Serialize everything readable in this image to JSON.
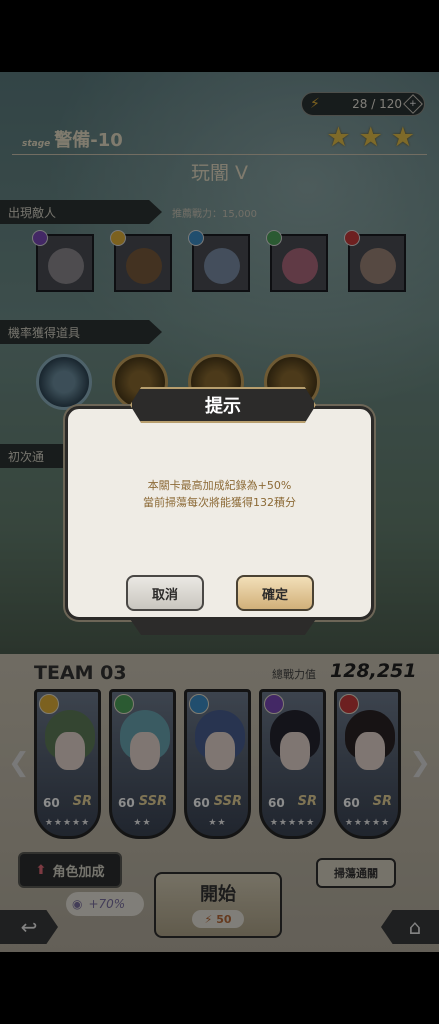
{
  "header": {
    "stamina": "28 / 120",
    "stage_prefix": "stage",
    "stage_code": "警備-10",
    "stage_name": "玩闇 V",
    "stars_earned": 3
  },
  "sections": {
    "enemies_label": "出現敵人",
    "power_requirement": "推薦戰力：15,000",
    "drops_label": "機率獲得道具",
    "first_clear_label": "初次通"
  },
  "dialog": {
    "title": "提示",
    "line1": "本關卡最高加成紀錄為+50%",
    "line2": "當前掃蕩每次將能獲得132積分",
    "cancel_label": "取消",
    "confirm_label": "確定"
  },
  "team": {
    "name": "TEAM 03",
    "power_label": "總戰力值",
    "power_value": "128,251",
    "cards": [
      {
        "level": "60",
        "rarity": "SR",
        "stars": "★★★★★",
        "element_color": "#e2b13a",
        "hair": "#5f7f5a"
      },
      {
        "level": "60",
        "rarity": "SSR",
        "stars": "★★",
        "element_color": "#4fa55c",
        "hair": "#6aa6b2"
      },
      {
        "level": "60",
        "rarity": "SSR",
        "stars": "★★",
        "element_color": "#3d8fc8",
        "hair": "#4a5f93"
      },
      {
        "level": "60",
        "rarity": "SR",
        "stars": "★★★★★",
        "element_color": "#7a4ab8",
        "hair": "#262530"
      },
      {
        "level": "60",
        "rarity": "SR",
        "stars": "★★★★★",
        "element_color": "#c63b3b",
        "hair": "#2a2325"
      }
    ]
  },
  "controls": {
    "boost_label": "角色加成",
    "boost_value": "+70%",
    "start_label": "開始",
    "start_cost": "50",
    "sweep_label": "掃蕩通關"
  },
  "colors": {
    "accent_gold": "#e6c24b",
    "dialog_text": "#8c6a36"
  }
}
